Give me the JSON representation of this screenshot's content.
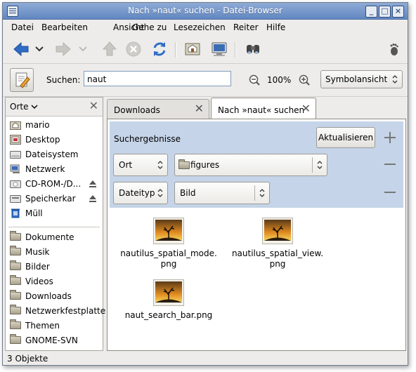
{
  "window": {
    "title": "Nach »naut« suchen - Datei-Browser"
  },
  "menubar": {
    "items": [
      {
        "label": "Datei"
      },
      {
        "label": "Bearbeiten"
      },
      {
        "label": "Ansicht"
      },
      {
        "label": "Gehe zu"
      },
      {
        "label": "Lesezeichen"
      },
      {
        "label": "Reiter"
      },
      {
        "label": "Hilfe"
      }
    ]
  },
  "toolbar": {
    "buttons": [
      "back-icon",
      "history-dropdown",
      "forward-icon",
      "forward-dropdown",
      "up-icon",
      "stop-icon",
      "reload-icon",
      "home-icon",
      "computer-icon",
      "search-binoculars-icon",
      "foot-logo"
    ]
  },
  "search": {
    "label": "Suchen:",
    "value": "naut",
    "zoom": "100%",
    "view_mode": "Symbolansicht"
  },
  "sidebar": {
    "selector": "Orte",
    "places": [
      {
        "label": "mario",
        "icon": "home-folder-icon"
      },
      {
        "label": "Desktop",
        "icon": "desktop-icon"
      },
      {
        "label": "Dateisystem",
        "icon": "drive-icon"
      },
      {
        "label": "Netzwerk",
        "icon": "network-icon"
      },
      {
        "label": "CD-ROM-/D...",
        "icon": "cdrom-icon",
        "eject": true
      },
      {
        "label": "Speicherkar",
        "icon": "memorycard-icon",
        "eject": true
      },
      {
        "label": "Müll",
        "icon": "trash-icon"
      }
    ],
    "bookmarks": [
      {
        "label": "Dokumente"
      },
      {
        "label": "Musik"
      },
      {
        "label": "Bilder"
      },
      {
        "label": "Videos"
      },
      {
        "label": "Downloads"
      },
      {
        "label": "Netzwerkfestplatte"
      },
      {
        "label": "Themen"
      },
      {
        "label": "GNOME-SVN"
      }
    ]
  },
  "tabs": [
    {
      "label": "Downloads",
      "active": false
    },
    {
      "label": "Nach »naut« suchen",
      "active": true
    }
  ],
  "query": {
    "title": "Suchergebnisse",
    "refresh": "Aktualisieren",
    "rows": [
      {
        "type": "Ort",
        "value": "figures"
      },
      {
        "type": "Dateityp",
        "value": "Bild"
      }
    ]
  },
  "files": [
    {
      "name1": "nautilus_spatial_mode.",
      "name2": "png"
    },
    {
      "name1": "nautilus_spatial_view.",
      "name2": "png"
    },
    {
      "name1": "naut_search_bar.png",
      "name2": ""
    }
  ],
  "status": {
    "text": "3 Objekte"
  },
  "colors": {
    "titlebar": "#6f91c8",
    "query_bg": "#c5d4e8",
    "accent_blue": "#2f6cc4"
  }
}
